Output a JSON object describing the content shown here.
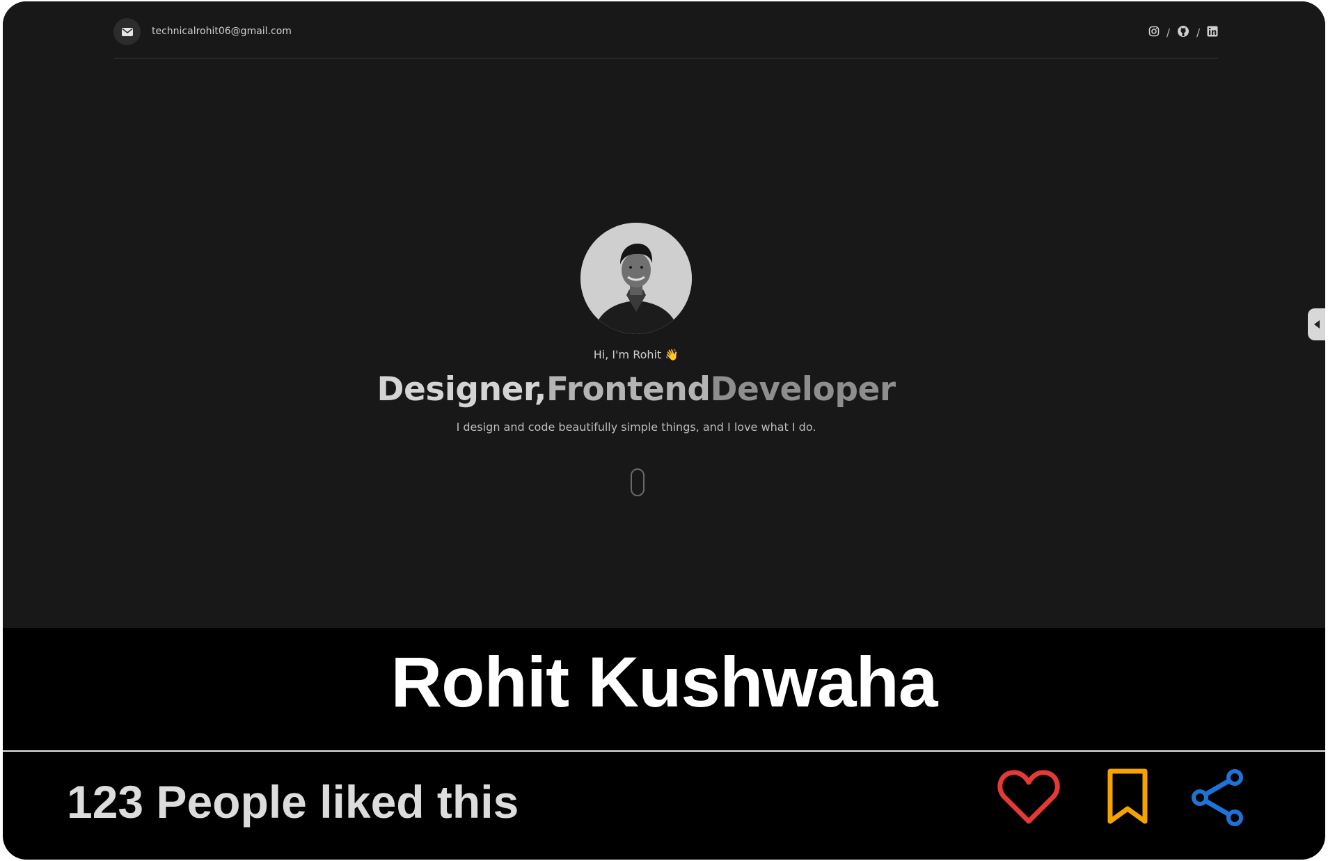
{
  "header": {
    "email": "technicalrohit06@gmail.com",
    "icons": [
      "mail-icon",
      "instagram-icon",
      "github-icon",
      "linkedin-icon"
    ],
    "separator": "/"
  },
  "hero": {
    "greeting": "Hi, I'm Rohit 👋",
    "headline_parts": [
      "Designer, ",
      "Frontend ",
      "Developer"
    ],
    "subtext": "I design and code beautifully simple things, and I love what I do."
  },
  "footer": {
    "name": "Rohit Kushwaha",
    "likes_text": "123 People liked this"
  },
  "colors": {
    "page_bg": "#181818",
    "card_bg": "#000000",
    "heart": "#e53935",
    "bookmark": "#f4a300",
    "share": "#1e73d8"
  }
}
